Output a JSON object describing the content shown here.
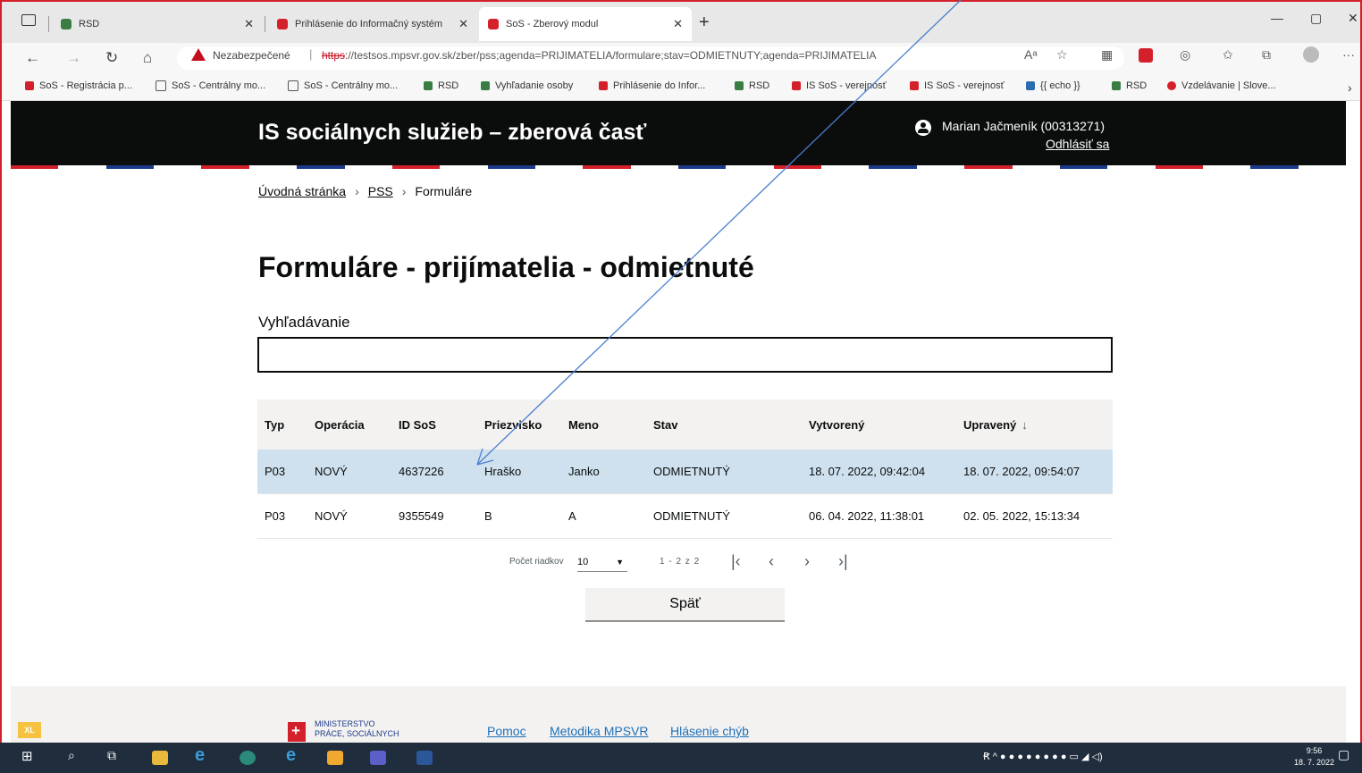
{
  "tabs": [
    {
      "title": "RSD"
    },
    {
      "title": "Prihlásenie do Informačný systém"
    },
    {
      "title": "SoS - Zberový modul"
    }
  ],
  "address": {
    "not_secure": "Nezabezpečené",
    "https": "https",
    "url_rest": "://testsos.mpsvr.gov.sk/zber/pss;agenda=PRIJIMATELIA/formulare;stav=ODMIETNUTY;agenda=PRIJIMATELIA"
  },
  "bookmarks": [
    {
      "label": "SoS - Registrácia p..."
    },
    {
      "label": "SoS - Centrálny mo..."
    },
    {
      "label": "SoS - Centrálny mo..."
    },
    {
      "label": "RSD"
    },
    {
      "label": "Vyhľadanie osoby"
    },
    {
      "label": "Prihlásenie do Infor..."
    },
    {
      "label": "RSD"
    },
    {
      "label": "IS SoS - verejnosť"
    },
    {
      "label": "IS SoS - verejnosť"
    },
    {
      "label": "{{ echo }}"
    },
    {
      "label": "RSD"
    },
    {
      "label": "Vzdelávanie | Slove..."
    }
  ],
  "header": {
    "title": "IS sociálnych služieb – zberová časť",
    "user": "Marian Jačmeník (00313271)",
    "logout": "Odhlásiť sa"
  },
  "breadcrumb": {
    "home": "Úvodná stránka",
    "pss": "PSS",
    "current": "Formuláre"
  },
  "page_title": "Formuláre - prijímatelia - odmietnuté",
  "search": {
    "label": "Vyhľadávanie",
    "value": ""
  },
  "table": {
    "headers": [
      "Typ",
      "Operácia",
      "ID SoS",
      "Priezvisko",
      "Meno",
      "Stav",
      "Vytvorený",
      "Upravený"
    ],
    "rows": [
      [
        "P03",
        "NOVÝ",
        "4637226",
        "Hraško",
        "Janko",
        "ODMIETNUTÝ",
        "18. 07. 2022, 09:42:04",
        "18. 07. 2022, 09:54:07"
      ],
      [
        "P03",
        "NOVÝ",
        "9355549",
        "B",
        "A",
        "ODMIETNUTÝ",
        "06. 04. 2022, 11:38:01",
        "02. 05. 2022, 15:13:34"
      ]
    ]
  },
  "pagination": {
    "rows_label": "Počet riadkov",
    "rows_value": "10",
    "range": "1 - 2 z 2"
  },
  "back_button": "Späť",
  "footer": {
    "ministry_line1": "MINISTERSTVO",
    "ministry_line2": "PRÁCE, SOCIÁLNYCH",
    "links": [
      "Pomoc",
      "Metodika MPSVR",
      "Hlásenie chýb"
    ],
    "badge": "XL"
  },
  "clock": {
    "time": "9:56",
    "date": "18. 7. 2022"
  },
  "colors": {
    "header_bg": "#0b0c0c",
    "highlight_row": "#cfe1ef",
    "accent_red": "#d4202a",
    "accent_blue": "#1d3a8a"
  }
}
